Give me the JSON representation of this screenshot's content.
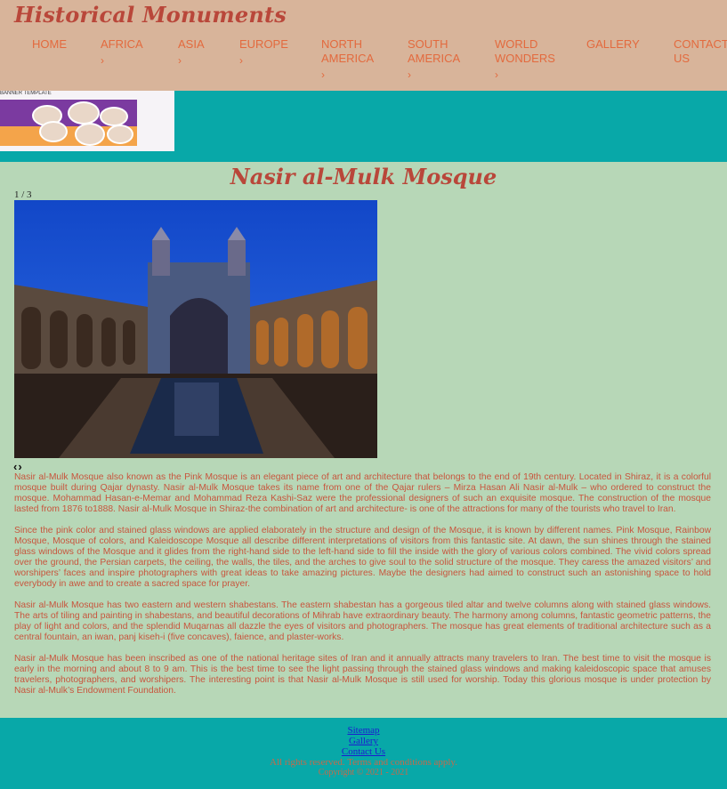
{
  "header": {
    "logo": "Historical Monuments",
    "nav": [
      {
        "line1": "HOME",
        "line2": "",
        "chevron": false
      },
      {
        "line1": "AFRICA",
        "line2": "",
        "chevron": true
      },
      {
        "line1": "ASIA",
        "line2": "",
        "chevron": true
      },
      {
        "line1": "EUROPE",
        "line2": "",
        "chevron": true
      },
      {
        "line1": "NORTH",
        "line2": "AMERICA",
        "chevron": true
      },
      {
        "line1": "SOUTH",
        "line2": "AMERICA",
        "chevron": true
      },
      {
        "line1": "WORLD",
        "line2": "WONDERS",
        "chevron": true
      },
      {
        "line1": "GALLERY",
        "line2": "",
        "chevron": false
      },
      {
        "line1": "CONTACT",
        "line2": "US",
        "chevron": false
      }
    ],
    "chevron_glyph": "›"
  },
  "banner": {
    "caption": "BANNER TEMPLATE"
  },
  "main": {
    "title": "Nasir al-Mulk Mosque",
    "slide_counter": "1 / 3",
    "prev": "‹",
    "next": "›",
    "paragraphs": [
      "Nasir al-Mulk Mosque also known as the Pink Mosque is an elegant piece of art and architecture that belongs to the end of 19th century. Located in Shiraz, it is a colorful mosque built during Qajar dynasty. Nasir al-Mulk Mosque takes its name from one of the Qajar rulers – Mirza Hasan Ali Nasir al-Mulk – who ordered to construct the mosque. Mohammad Hasan-e-Memar and Mohammad Reza Kashi-Saz were the professional designers of such an exquisite mosque. The construction of the mosque lasted from 1876 to1888. Nasir al-Mulk Mosque in Shiraz-the combination of art and architecture- is one of the attractions for many of the tourists who travel to Iran.",
      "Since the pink color and stained glass windows are applied elaborately in the structure and design of the Mosque, it is known by different names. Pink Mosque, Rainbow Mosque, Mosque of colors, and Kaleidoscope Mosque all describe different interpretations of visitors from this fantastic site. At dawn, the sun shines through the stained glass windows of the Mosque and it glides from the right-hand side to the left-hand side to fill the inside with the glory of various colors combined. The vivid colors spread over the ground, the Persian carpets, the ceiling, the walls, the tiles, and the arches to give soul to the solid structure of the mosque. They caress the amazed visitors’ and worshipers’ faces and inspire photographers with great ideas to take amazing pictures. Maybe the designers had aimed to construct such an astonishing space to hold everybody in awe and to create a sacred space for prayer.",
      "Nasir al-Mulk Mosque has two eastern and western shabestans. The eastern shabestan has a gorgeous tiled altar and twelve columns along with stained glass windows. The arts of tiling and painting in shabestans, and beautiful decorations of Mihrab have extraordinary beauty. The harmony among columns, fantastic geometric patterns, the play of light and colors, and the splendid Muqarnas all dazzle the eyes of visitors and photographers. The mosque has great elements of traditional architecture such as a central fountain, an iwan, panj kiseh-i (five concaves), faience, and plaster-works.",
      "Nasir al-Mulk Mosque has been inscribed as one of the national heritage sites of Iran and it annually attracts many travelers to Iran. The best time to visit the mosque is early in the morning and about 8 to 9 am. This is the best time to see the light passing through the stained glass windows and making kaleidoscopic space that amuses travelers, photographers, and worshipers. The interesting point is that Nasir al-Mulk Mosque is still used for worship. Today this glorious mosque is under protection by Nasir al-Mulk’s Endowment Foundation."
    ]
  },
  "footer": {
    "links": [
      "Sitemap",
      "Gallery",
      "Contact Us"
    ],
    "rights": "All rights reserved. Terms and conditions apply.",
    "copyright": "Copyright © 2021 - 2021"
  },
  "colors": {
    "header_bg": "#d8b49a",
    "teal": "#08a8a8",
    "page_bg": "#b7d7b7",
    "accent": "#e36a3e",
    "title": "#b9473a",
    "text": "#c8553d"
  },
  "icons": {
    "nav_chevron": "chevron-right-icon",
    "prev": "chevron-left-icon",
    "next": "chevron-right-icon"
  }
}
